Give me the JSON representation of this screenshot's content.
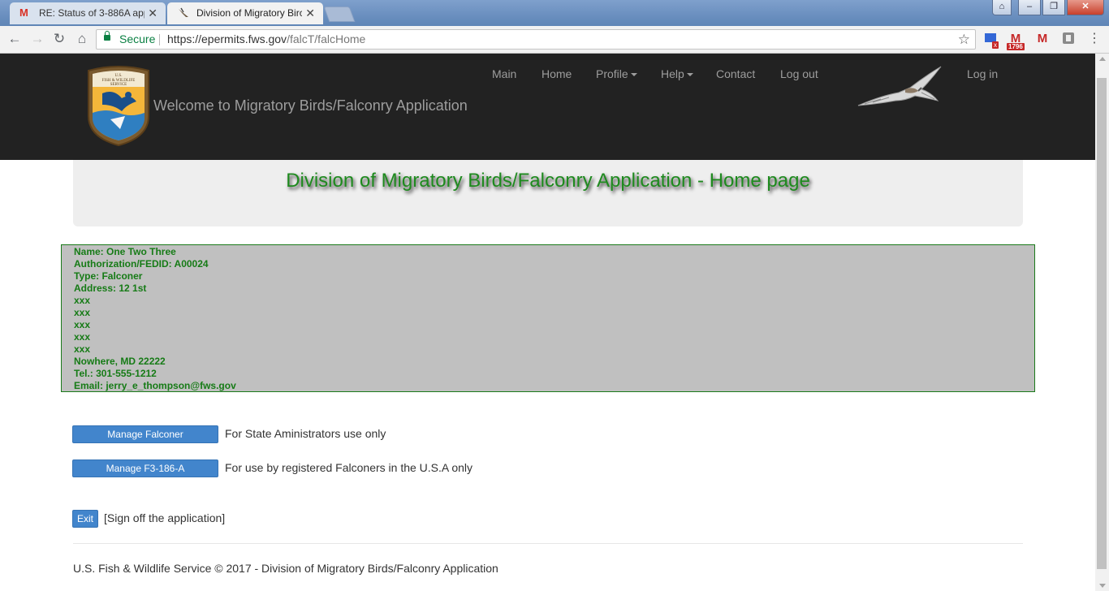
{
  "browser": {
    "tabs": [
      {
        "title": "RE: Status of 3-886A app",
        "icon": "gmail-icon",
        "close": "✕"
      },
      {
        "title": "Division of Migratory Birc",
        "icon": "hawk-favicon",
        "close": "✕"
      }
    ],
    "secure_label": "Secure",
    "url_host": "https://epermits.fws.gov",
    "url_path": "/falcT/falcHome",
    "extensions": [
      {
        "name": "extension-icon",
        "badge": ""
      },
      {
        "name": "gmail-extension-icon",
        "badge": "1796"
      },
      {
        "name": "mail-checker-icon",
        "badge": ""
      },
      {
        "name": "extension-icon-2",
        "badge": ""
      }
    ]
  },
  "header": {
    "welcome": "Welcome to Migratory Birds/Falconry Application",
    "nav": [
      {
        "label": "Main",
        "dropdown": false
      },
      {
        "label": "Home",
        "dropdown": false
      },
      {
        "label": "Profile",
        "dropdown": true
      },
      {
        "label": "Help",
        "dropdown": true
      },
      {
        "label": "Contact",
        "dropdown": false
      },
      {
        "label": "Log out",
        "dropdown": false
      }
    ],
    "login": "Log in"
  },
  "jumbotron": {
    "title": "Division of Migratory Birds/Falconry Application - Home page"
  },
  "user_info": {
    "lines": [
      "Name: One Two Three",
      "Authorization/FEDID: A00024",
      "Type: Falconer",
      "Address: 12 1st",
      "xxx",
      "xxx",
      "xxx",
      "xxx",
      "xxx",
      "Nowhere, MD 22222",
      "Tel.: 301-555-1212",
      "Email: jerry_e_thompson@fws.gov"
    ]
  },
  "actions": {
    "manage_falconer": {
      "label": "Manage Falconer",
      "desc": "For State Aministrators use only"
    },
    "manage_f3": {
      "label": "Manage F3-186-A",
      "desc": "For use by registered Falconers in the U.S.A only"
    },
    "exit": {
      "label": "Exit",
      "desc": "[Sign off the application]"
    }
  },
  "footer": {
    "text": "U.S. Fish & Wildlife Service © 2017 - Division of Migratory Birds/Falconry Application"
  },
  "colors": {
    "header_bg": "#222222",
    "accent_green": "#1e8a1e",
    "button_blue": "#4285cc",
    "info_bg": "#c0c0c0"
  }
}
